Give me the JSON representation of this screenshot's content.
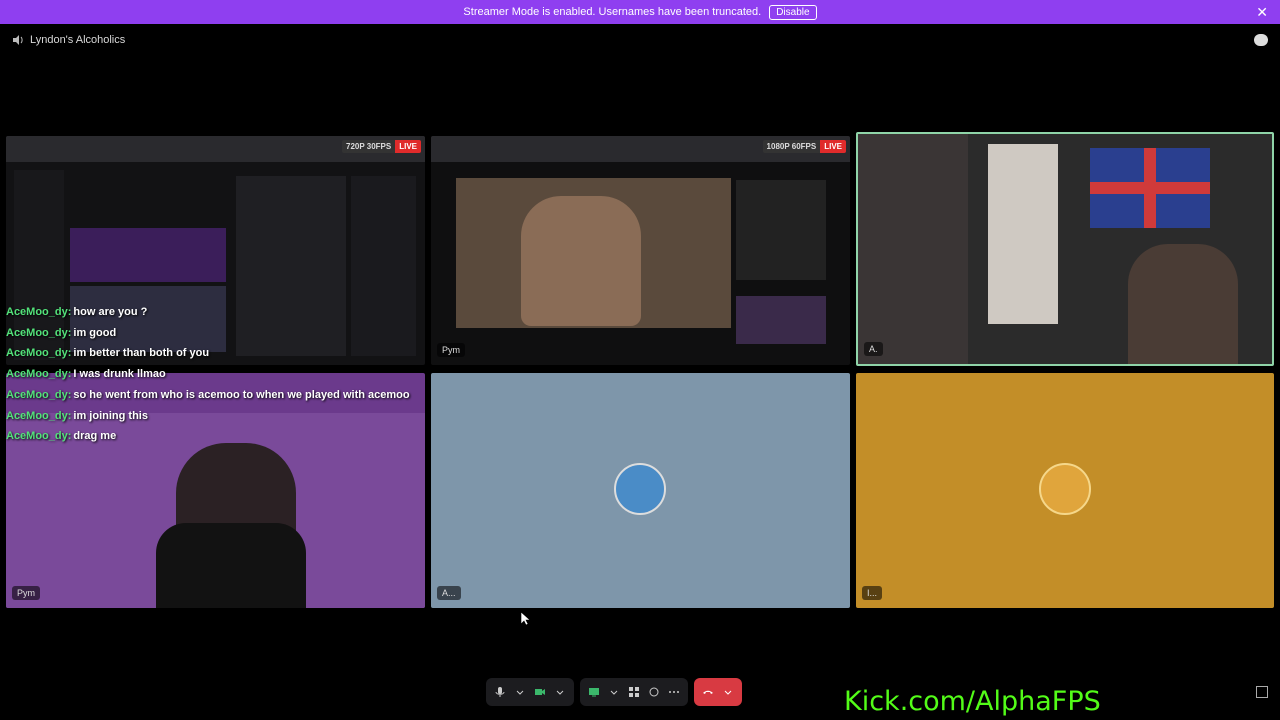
{
  "banner": {
    "text": "Streamer Mode is enabled. Usernames have been truncated.",
    "button": "Disable",
    "close": "✕"
  },
  "channel": {
    "name": "Lyndon's Alcoholics"
  },
  "tiles": [
    {
      "id": "tile-stream-1",
      "quality": "720P 30FPS",
      "live": "LIVE"
    },
    {
      "id": "tile-stream-2",
      "quality": "1080P 60FPS",
      "live": "LIVE",
      "name": "Pym"
    },
    {
      "id": "tile-cam-3",
      "name": "A."
    },
    {
      "id": "tile-cam-pym",
      "name": "Pym"
    },
    {
      "id": "tile-avatar-a",
      "name": "A...",
      "bg": "#7e96aa"
    },
    {
      "id": "tile-avatar-i",
      "name": "I...",
      "bg": "#c38e28"
    }
  ],
  "chat": [
    {
      "user": "AceMoo_dy:",
      "msg": "how are you ?"
    },
    {
      "user": "AceMoo_dy:",
      "msg": "im good"
    },
    {
      "user": "AceMoo_dy:",
      "msg": "im better than both of you"
    },
    {
      "user": "AceMoo_dy:",
      "msg": "I was drunk llmao"
    },
    {
      "user": "AceMoo_dy:",
      "msg": "so he went from who is acemoo to when we played with acemoo"
    },
    {
      "user": "AceMoo_dy:",
      "msg": "im joining this"
    },
    {
      "user": "AceMoo_dy:",
      "msg": "drag me"
    }
  ],
  "overlay": {
    "kick_url": "Kick.com/AlphaFPS"
  },
  "colors": {
    "accent": "#8f3ff0",
    "chat_user": "#53e27a",
    "kick_green": "#53fc18",
    "leave": "#d83a42",
    "tile_border": "#8fd4a8"
  }
}
